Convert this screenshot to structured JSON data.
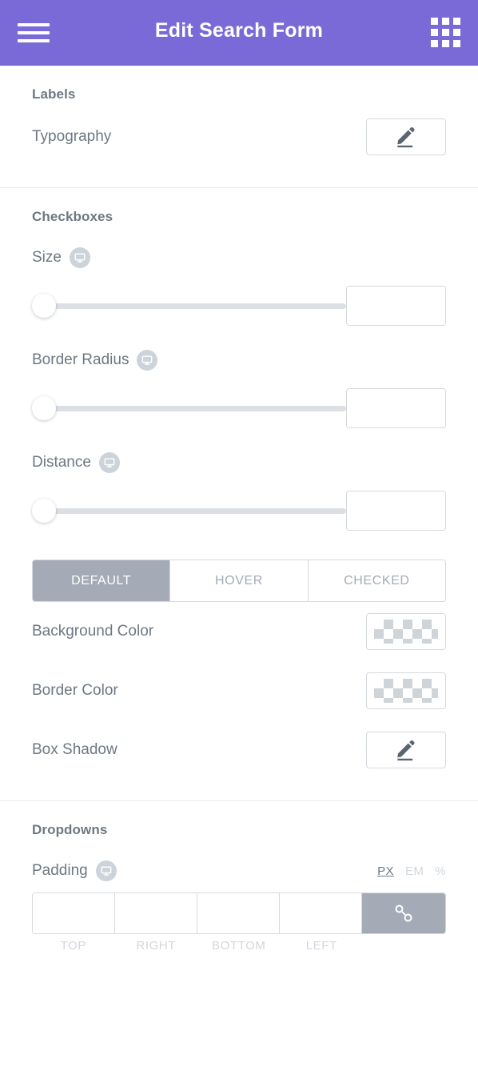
{
  "header": {
    "title": "Edit Search Form",
    "menu_icon": "hamburger-menu-icon",
    "apps_icon": "grid-apps-icon"
  },
  "sections": [
    {
      "title": "Labels",
      "rows": [
        {
          "label": "Typography",
          "control": "edit-button",
          "icon": "pencil-icon"
        }
      ]
    },
    {
      "title": "Checkboxes",
      "rows": [
        {
          "label": "Size",
          "device": "desktop-icon",
          "control": "slider",
          "value": "",
          "slider_position": 0
        },
        {
          "label": "Border Radius",
          "device": "desktop-icon",
          "control": "slider",
          "value": "",
          "slider_position": 0
        },
        {
          "label": "Distance",
          "device": "desktop-icon",
          "control": "slider",
          "value": "",
          "slider_position": 0
        }
      ],
      "tabs": [
        {
          "label": "DEFAULT",
          "active": true
        },
        {
          "label": "HOVER",
          "active": false
        },
        {
          "label": "CHECKED",
          "active": false
        }
      ],
      "state_rows": [
        {
          "label": "Background Color",
          "control": "color-swatch",
          "value": "transparent"
        },
        {
          "label": "Border Color",
          "control": "color-swatch",
          "value": "transparent"
        },
        {
          "label": "Box Shadow",
          "control": "edit-button",
          "icon": "pencil-icon"
        }
      ]
    },
    {
      "title": "Dropdowns",
      "padding": {
        "label": "Padding",
        "device": "desktop-icon",
        "units": [
          {
            "label": "PX",
            "active": true
          },
          {
            "label": "EM",
            "active": false
          },
          {
            "label": "%",
            "active": false
          }
        ],
        "fields": [
          {
            "label": "TOP",
            "value": ""
          },
          {
            "label": "RIGHT",
            "value": ""
          },
          {
            "label": "BOTTOM",
            "value": ""
          },
          {
            "label": "LEFT",
            "value": ""
          }
        ],
        "link_icon": "link-chain-icon",
        "link_active": true
      }
    }
  ],
  "colors": {
    "header_bg": "#7a6ad8",
    "text": "#6d7882",
    "muted": "#a4abb6",
    "border": "#d5dadf",
    "divider": "#e6e9ec",
    "track": "#dce0e5"
  }
}
